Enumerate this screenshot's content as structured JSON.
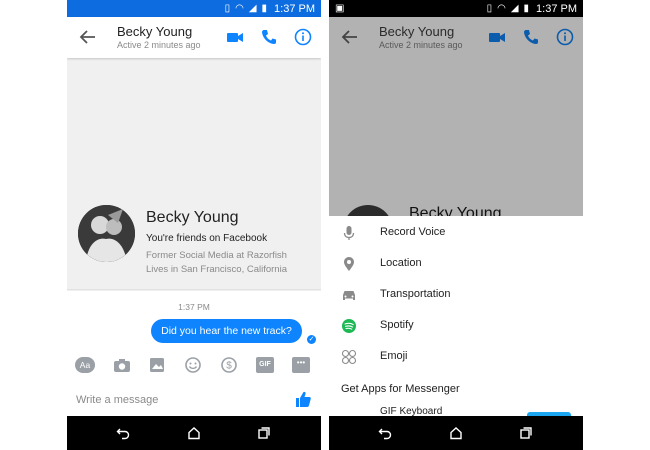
{
  "status_bar": {
    "time": "1:37 PM"
  },
  "header": {
    "contact_name": "Becky Young",
    "active_status": "Active 2 minutes ago"
  },
  "contact_card": {
    "name": "Becky Young",
    "relationship": "You're friends on Facebook",
    "work": "Former Social Media at Razorfish",
    "location": "Lives in San Francisco, California"
  },
  "conversation": {
    "timestamp": "1:37 PM",
    "messages": [
      {
        "text": "Did you hear the new track?",
        "from": "me",
        "seen": true
      }
    ]
  },
  "composer": {
    "placeholder": "Write a message",
    "tools": [
      "Aa",
      "camera-icon",
      "photo-icon",
      "emoji-icon",
      "payment-icon",
      "GIF",
      "more-icon"
    ]
  },
  "more_sheet": {
    "items": [
      {
        "label": "Record Voice",
        "icon": "microphone-icon"
      },
      {
        "label": "Location",
        "icon": "location-pin-icon"
      },
      {
        "label": "Transportation",
        "icon": "car-icon"
      },
      {
        "label": "Spotify",
        "icon": "spotify-icon"
      },
      {
        "label": "Emoji",
        "icon": "emoji-grid-icon"
      }
    ],
    "section_title": "Get Apps for Messenger",
    "next_app": "GIF Keyboard"
  },
  "colors": {
    "messenger_blue": "#0f84ff",
    "status_bar_blue": "#0d6ce0",
    "spotify_green": "#1db954",
    "dim_overlay": "#b2b2b2"
  }
}
